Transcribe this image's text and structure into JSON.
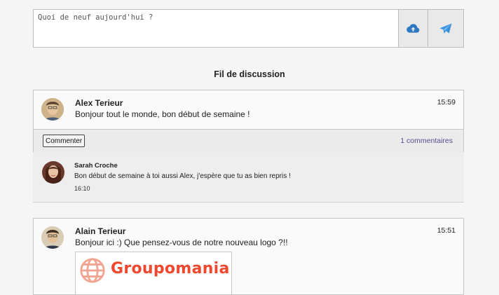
{
  "composer": {
    "placeholder": "Quoi de neuf aujourd'hui ?",
    "upload_icon": "cloud-upload-icon",
    "send_icon": "paper-plane-icon"
  },
  "feed": {
    "title": "Fil de discussion"
  },
  "posts": [
    {
      "author": "Alex Terieur",
      "time": "15:59",
      "content": "Bonjour tout le monde, bon début de semaine !",
      "comment_button": "Commenter",
      "comment_count": "1 commentaires",
      "comments": [
        {
          "author": "Sarah Croche",
          "text": "Bon début de semaine à toi aussi Alex, j'espère que tu as bien repris !",
          "time": "16:10"
        }
      ]
    },
    {
      "author": "Alain Terieur",
      "time": "15:51",
      "content": "Bonjour ici :) Que pensez-vous de notre nouveau logo ?!!",
      "image_text": "Groupomania"
    }
  ],
  "colors": {
    "accent": "#2e8ad6",
    "brand": "#f0472e",
    "link": "#5b4a8f"
  }
}
